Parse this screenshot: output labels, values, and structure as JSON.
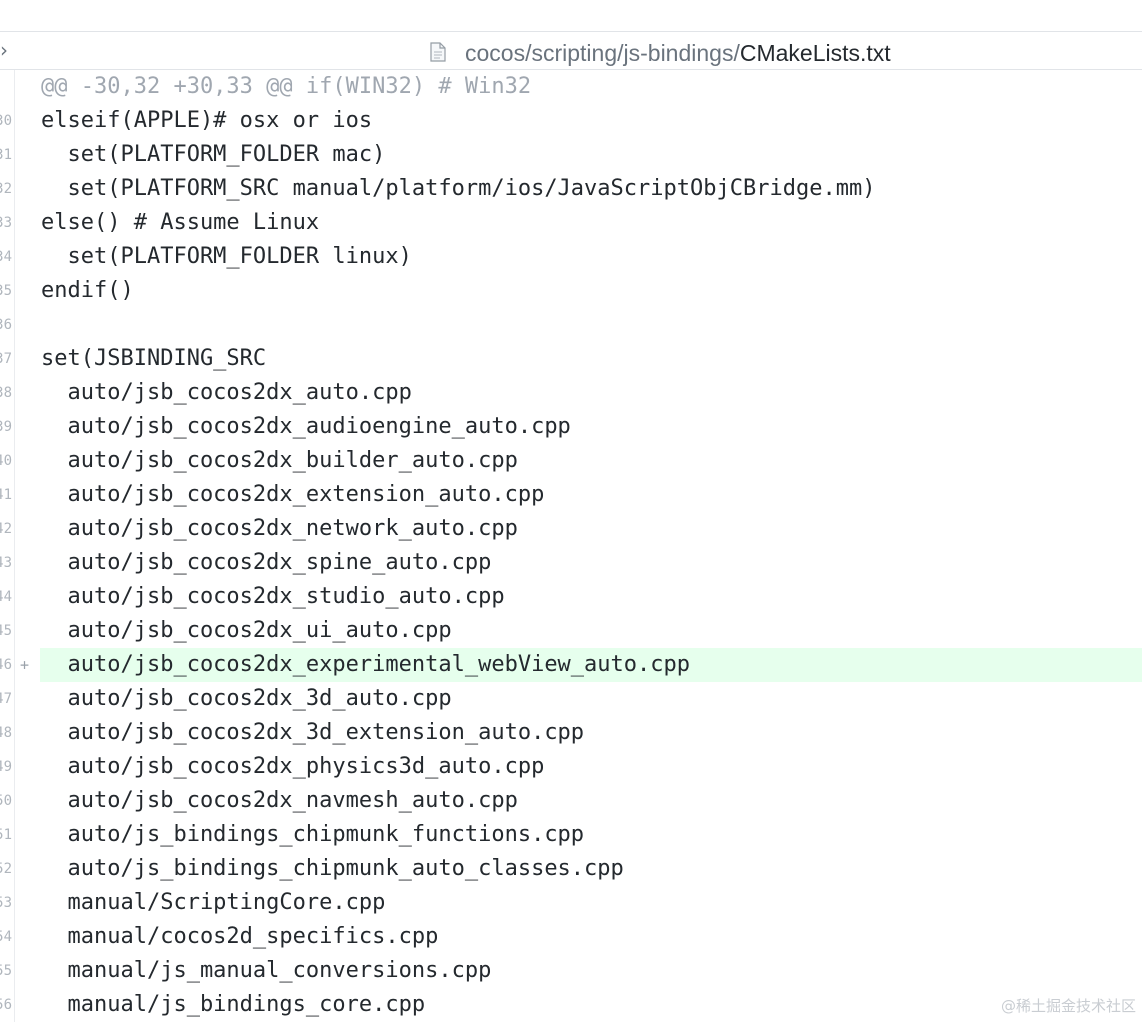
{
  "file_header": {
    "dir_path": "cocos/scripting/js-bindings/",
    "file_name": "CMakeLists.txt",
    "file_icon": "file-text-icon",
    "collapse_icon": "chevron-right-icon"
  },
  "diff": {
    "lines": [
      {
        "num": "",
        "marker": "",
        "type": "hunk",
        "text": "@@ -30,32 +30,33 @@ if(WIN32) # Win32"
      },
      {
        "num": "30",
        "marker": "",
        "type": "context",
        "text": "elseif(APPLE)# osx or ios"
      },
      {
        "num": "31",
        "marker": "",
        "type": "context",
        "text": "  set(PLATFORM_FOLDER mac)"
      },
      {
        "num": "32",
        "marker": "",
        "type": "context",
        "text": "  set(PLATFORM_SRC manual/platform/ios/JavaScriptObjCBridge.mm)"
      },
      {
        "num": "33",
        "marker": "",
        "type": "context",
        "text": "else() # Assume Linux"
      },
      {
        "num": "34",
        "marker": "",
        "type": "context",
        "text": "  set(PLATFORM_FOLDER linux)"
      },
      {
        "num": "35",
        "marker": "",
        "type": "context",
        "text": "endif()"
      },
      {
        "num": "36",
        "marker": "",
        "type": "context",
        "text": ""
      },
      {
        "num": "37",
        "marker": "",
        "type": "context",
        "text": "set(JSBINDING_SRC"
      },
      {
        "num": "38",
        "marker": "",
        "type": "context",
        "text": "  auto/jsb_cocos2dx_auto.cpp"
      },
      {
        "num": "39",
        "marker": "",
        "type": "context",
        "text": "  auto/jsb_cocos2dx_audioengine_auto.cpp"
      },
      {
        "num": "40",
        "marker": "",
        "type": "context",
        "text": "  auto/jsb_cocos2dx_builder_auto.cpp"
      },
      {
        "num": "41",
        "marker": "",
        "type": "context",
        "text": "  auto/jsb_cocos2dx_extension_auto.cpp"
      },
      {
        "num": "42",
        "marker": "",
        "type": "context",
        "text": "  auto/jsb_cocos2dx_network_auto.cpp"
      },
      {
        "num": "43",
        "marker": "",
        "type": "context",
        "text": "  auto/jsb_cocos2dx_spine_auto.cpp"
      },
      {
        "num": "44",
        "marker": "",
        "type": "context",
        "text": "  auto/jsb_cocos2dx_studio_auto.cpp"
      },
      {
        "num": "45",
        "marker": "",
        "type": "context",
        "text": "  auto/jsb_cocos2dx_ui_auto.cpp"
      },
      {
        "num": "46",
        "marker": "+",
        "type": "added",
        "text": "  auto/jsb_cocos2dx_experimental_webView_auto.cpp"
      },
      {
        "num": "47",
        "marker": "",
        "type": "context",
        "text": "  auto/jsb_cocos2dx_3d_auto.cpp"
      },
      {
        "num": "48",
        "marker": "",
        "type": "context",
        "text": "  auto/jsb_cocos2dx_3d_extension_auto.cpp"
      },
      {
        "num": "49",
        "marker": "",
        "type": "context",
        "text": "  auto/jsb_cocos2dx_physics3d_auto.cpp"
      },
      {
        "num": "50",
        "marker": "",
        "type": "context",
        "text": "  auto/jsb_cocos2dx_navmesh_auto.cpp"
      },
      {
        "num": "51",
        "marker": "",
        "type": "context",
        "text": "  auto/js_bindings_chipmunk_functions.cpp"
      },
      {
        "num": "52",
        "marker": "",
        "type": "context",
        "text": "  auto/js_bindings_chipmunk_auto_classes.cpp"
      },
      {
        "num": "53",
        "marker": "",
        "type": "context",
        "text": "  manual/ScriptingCore.cpp"
      },
      {
        "num": "54",
        "marker": "",
        "type": "context",
        "text": "  manual/cocos2d_specifics.cpp"
      },
      {
        "num": "55",
        "marker": "",
        "type": "context",
        "text": "  manual/js_manual_conversions.cpp"
      },
      {
        "num": "56",
        "marker": "",
        "type": "context",
        "text": "  manual/js_bindings_core.cpp"
      }
    ]
  },
  "watermark": "@稀土掘金技术社区",
  "colors": {
    "added_bg": "#e6ffed",
    "hunk_text": "#a0a7b0",
    "code_text": "#24292e",
    "path_dir": "#6a737d"
  }
}
